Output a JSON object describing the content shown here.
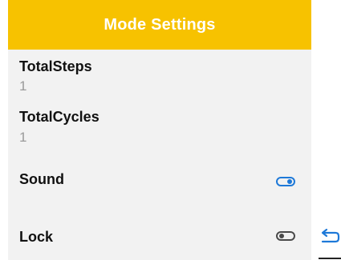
{
  "header": {
    "title": "Mode Settings"
  },
  "settings": {
    "total_steps": {
      "label": "TotalSteps",
      "value": "1"
    },
    "total_cycles": {
      "label": "TotalCycles",
      "value": "1"
    },
    "sound": {
      "label": "Sound",
      "enabled": true
    },
    "lock": {
      "label": "Lock",
      "enabled": false
    }
  },
  "icons": {
    "back": "back-arrow-icon"
  },
  "colors": {
    "header_bg": "#f7c200",
    "toggle_on": "#1e79d8",
    "toggle_off": "#4a4a4a",
    "value_text": "#9a9a9a"
  }
}
